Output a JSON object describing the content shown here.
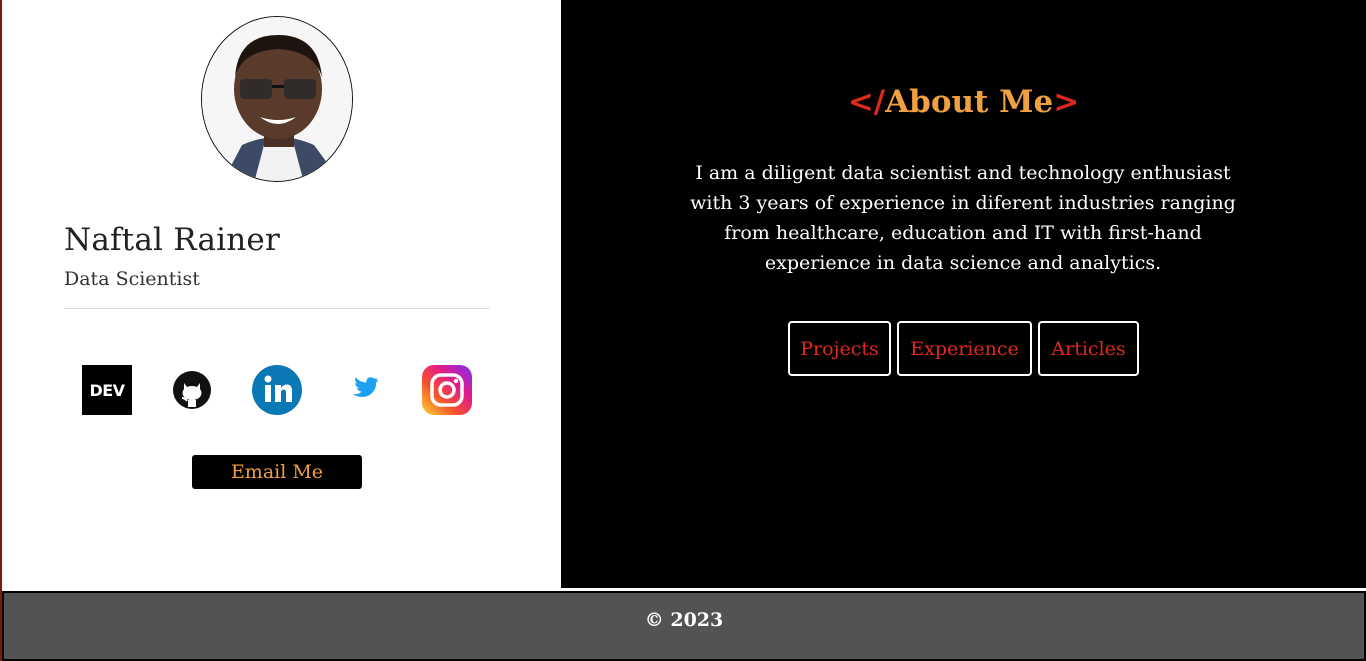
{
  "profile": {
    "name": "Naftal Rainer",
    "role": "Data Scientist"
  },
  "social": {
    "dev_label": "DEV",
    "icons": [
      "dev-icon",
      "github-icon",
      "linkedin-icon",
      "twitter-icon",
      "instagram-icon"
    ]
  },
  "contact": {
    "email_label": "Email Me"
  },
  "about": {
    "title_open": "</",
    "title_text": "About Me",
    "title_close": ">",
    "description": "I am a diligent data scientist and technology enthusiast with 3 years of experience in diferent industries ranging from healthcare, education and IT with first-hand experience in data science and analytics."
  },
  "nav": {
    "projects": "Projects",
    "experience": "Experience",
    "articles": "Articles"
  },
  "footer": {
    "text": "© 2023"
  },
  "colors": {
    "accent_orange": "#f0a040",
    "accent_red": "#e0281c",
    "panel_dark": "#000000",
    "footer_bg": "#535255"
  }
}
